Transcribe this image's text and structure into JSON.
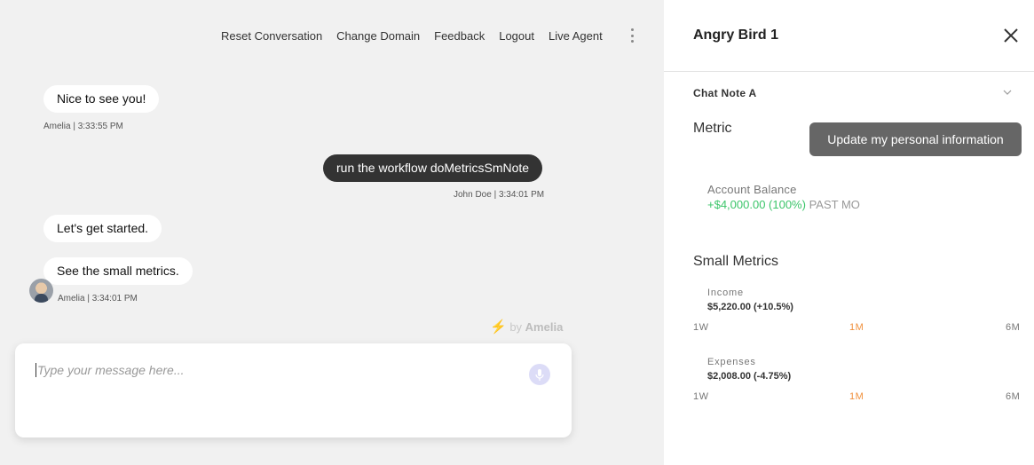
{
  "nav": {
    "items": [
      "Reset Conversation",
      "Change Domain",
      "Feedback",
      "Logout",
      "Live Agent"
    ]
  },
  "messages": [
    {
      "from": "bot",
      "text": "Nice to see you!"
    },
    {
      "meta": "Amelia | 3:33:55 PM"
    },
    {
      "from": "user",
      "text": "run the workflow doMetricsSmNote"
    },
    {
      "meta": "John Doe | 3:34:01 PM"
    },
    {
      "from": "bot",
      "text": "Let's get started."
    },
    {
      "from": "bot",
      "text": "See the small metrics."
    },
    {
      "meta": "Amelia | 3:34:01 PM"
    }
  ],
  "branding": {
    "prefix": "by",
    "name": "Amelia"
  },
  "composer": {
    "placeholder": "Type your message here..."
  },
  "panel": {
    "title": "Angry Bird 1",
    "note_title": "Chat Note A",
    "metric_title": "Metric",
    "tooltip": "Update my personal information",
    "account": {
      "label": "Account Balance",
      "change": "+$4,000.00 (100%)",
      "period": "PAST MO"
    },
    "small_metrics_title": "Small Metrics",
    "income": {
      "label": "Income",
      "value": "$5,220.00 (+10.5%)"
    },
    "expenses": {
      "label": "Expenses",
      "value": "$2,008.00 (-4.75%)"
    },
    "ranges": [
      "1W",
      "1M",
      "6M"
    ],
    "active_range": "1M"
  },
  "colors": {
    "positive": "#3cc56a",
    "active_range": "#f0903c",
    "user_bubble": "#333333",
    "tooltip": "#666666"
  }
}
